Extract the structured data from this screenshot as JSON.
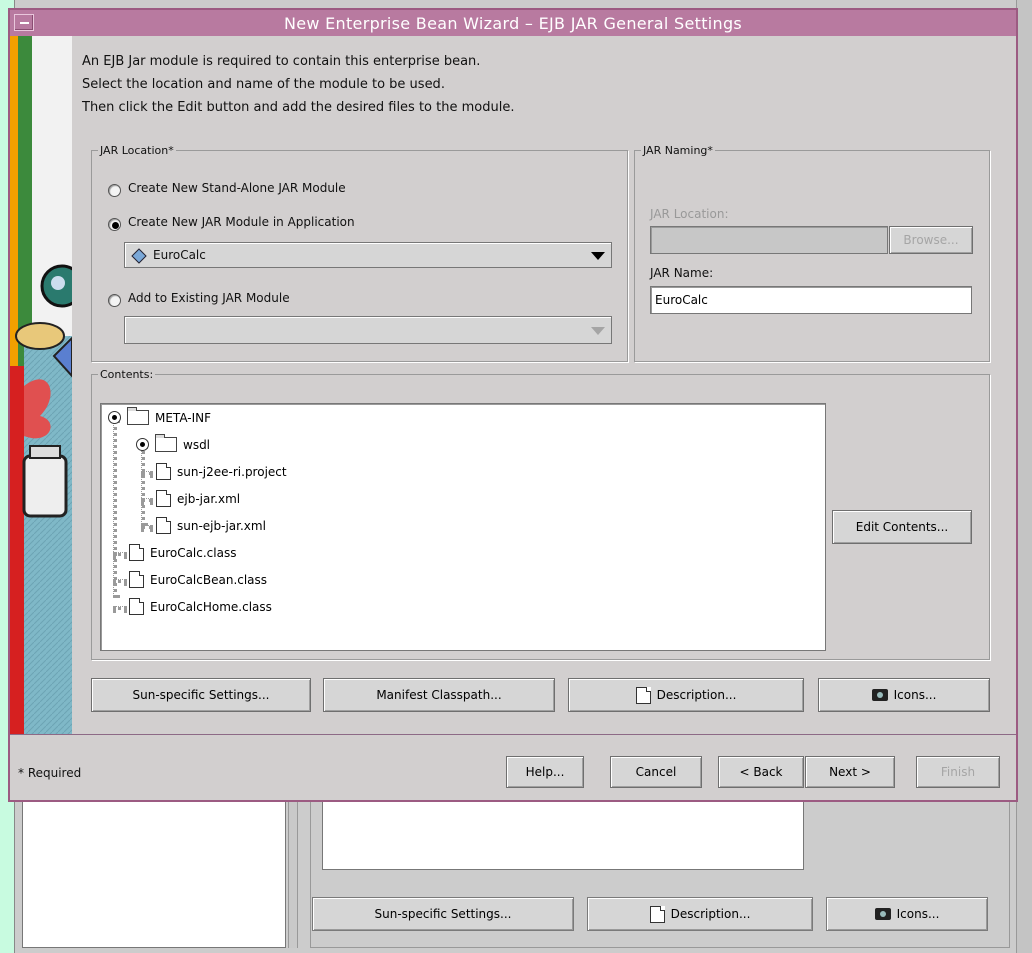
{
  "dialog": {
    "title": "New Enterprise Bean Wizard – EJB JAR General Settings",
    "intro": [
      "An EJB Jar module is required to contain this enterprise bean.",
      "Select the location and name of the module to be used.",
      "Then click the Edit button and add the desired files to the module."
    ],
    "jar_location": {
      "legend": "JAR Location*",
      "option_standalone": "Create New Stand-Alone JAR Module",
      "option_in_app": "Create New JAR Module in Application",
      "option_existing": "Add to Existing JAR Module",
      "selected_option": "option_in_app",
      "app_combo_value": "EuroCalc",
      "existing_combo_value": ""
    },
    "jar_naming": {
      "legend": "JAR Naming*",
      "location_label": "JAR Location:",
      "location_value": "",
      "browse_label": "Browse...",
      "name_label": "JAR Name:",
      "name_value": "EuroCalc"
    },
    "contents": {
      "legend": "Contents:",
      "tree": {
        "meta_inf": "META-INF",
        "wsdl": "wsdl",
        "project": "sun-j2ee-ri.project",
        "ejb_jar": "ejb-jar.xml",
        "sun_ejb_jar": "sun-ejb-jar.xml",
        "class1": "EuroCalc.class",
        "class2": "EuroCalcBean.class",
        "class3": "EuroCalcHome.class"
      },
      "edit_button": "Edit Contents..."
    },
    "bottom_buttons": {
      "sun_settings": "Sun-specific Settings...",
      "manifest": "Manifest Classpath...",
      "description": "Description...",
      "icons": "Icons..."
    },
    "footer": {
      "required_note": "* Required",
      "help": "Help...",
      "cancel": "Cancel",
      "back": "< Back",
      "next": "Next >",
      "finish": "Finish"
    }
  },
  "background_window": {
    "sun_settings": "Sun-specific Settings...",
    "description": "Description...",
    "icons": "Icons..."
  },
  "icons": {
    "combo_item": "diamond-icon",
    "tree_folder": "folder-icon",
    "tree_file": "file-icon",
    "description": "document-icon",
    "icons_btn": "camera-icon"
  },
  "colors": {
    "desktop": "#c8fbe0",
    "title_bar": "#b87aa0",
    "dialog_border": "#9c5b82",
    "dialog_bg": "#d2cfcf"
  }
}
